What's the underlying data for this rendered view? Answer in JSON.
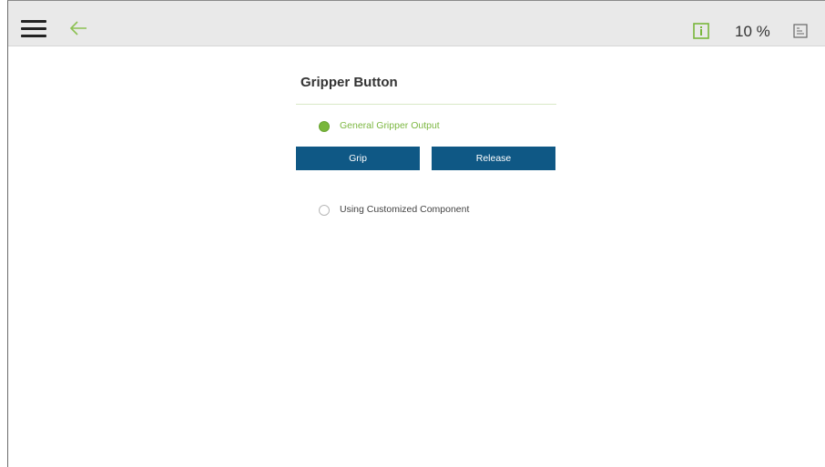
{
  "header": {
    "speed": "10 %",
    "icons": {
      "menu": "hamburger-menu-icon",
      "back": "back-arrow-icon",
      "info": "info-icon",
      "doc": "document-icon"
    },
    "colors": {
      "accent": "#7cb741",
      "bar_bg": "#e9e9e9"
    }
  },
  "panel": {
    "title": "Gripper Button",
    "options": [
      {
        "label": "General Gripper Output",
        "selected": true
      },
      {
        "label": "Using Customized Component",
        "selected": false
      }
    ],
    "buttons": {
      "grip": "Grip",
      "release": "Release"
    },
    "colors": {
      "button_bg": "#0f5885",
      "selected_radio": "#79b73b"
    }
  }
}
